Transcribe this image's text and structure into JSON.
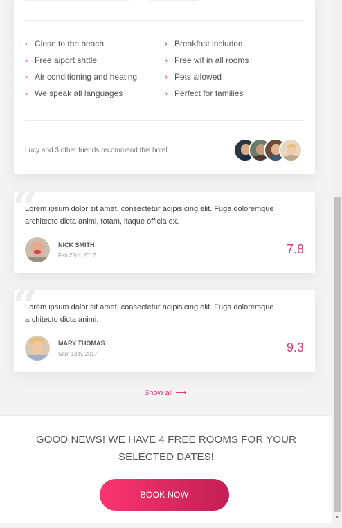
{
  "amenities": {
    "left": [
      "Close to the beach",
      "Free aiport shttle",
      "Air conditioning and heating",
      "We speak all languages"
    ],
    "right": [
      "Breakfast included",
      "Free wif in all rooms",
      "Pets allowed",
      "Perfect for families"
    ]
  },
  "recommend_text": "Lucy and 3 other friends recommend this hotel.",
  "reviews": [
    {
      "text": "Lorem ipsum dolor sit amet, consectetur adipisicing elit. Fuga doloremque architecto dicta animi, totam, itaque officia ex.",
      "name": "NICK SMITH",
      "date": "Feb 23rd, 2017",
      "score": "7.8"
    },
    {
      "text": "Lorem ipsum dolor sit amet, consectetur adipisicing elit. Fuga doloremque architecto dicta animi.",
      "name": "MARY THOMAS",
      "date": "Sept 13th, 2017",
      "score": "9.3"
    }
  ],
  "show_all": "Show all",
  "good_news": "GOOD NEWS! WE HAVE 4 FREE ROOMS FOR YOUR SELECTED DATES!",
  "book_now": "BOOK NOW",
  "colors": {
    "accent": "#d33a73",
    "button_start": "#fb3570",
    "button_end": "#c21e55"
  },
  "icons": {
    "bullet": "chevron-right-icon",
    "quote": "quote-icon",
    "arrow": "arrow-right-icon"
  }
}
